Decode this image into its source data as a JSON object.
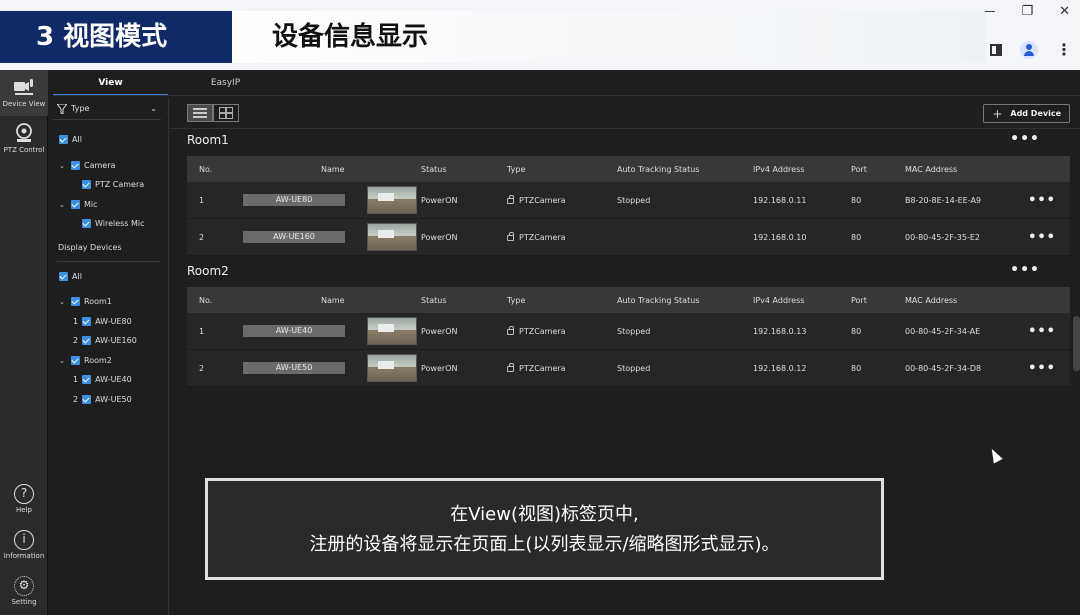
{
  "banner": {
    "number": "3 视图模式",
    "title": "设备信息显示"
  },
  "iconbar": {
    "device_view": "Device View",
    "ptz_control": "PTZ Control",
    "help": "Help",
    "information": "Information",
    "setting": "Setting"
  },
  "tabs": {
    "view": "View",
    "easyip": "EasyIP"
  },
  "sidebar": {
    "filter_label": "Type",
    "all": "All",
    "camera": "Camera",
    "ptz_camera": "PTZ Camera",
    "mic": "Mic",
    "wireless_mic": "Wireless Mic",
    "display_devices": "Display Devices",
    "all2": "All",
    "room1": "Room1",
    "room1_dev1_no": "1",
    "room1_dev1": "AW-UE80",
    "room1_dev2_no": "2",
    "room1_dev2": "AW-UE160",
    "room2": "Room2",
    "room2_dev1_no": "1",
    "room2_dev1": "AW-UE40",
    "room2_dev2_no": "2",
    "room2_dev2": "AW-UE50"
  },
  "toolbar": {
    "add_device": "Add Device"
  },
  "columns": {
    "no": "No.",
    "name": "Name",
    "status": "Status",
    "type": "Type",
    "tracking": "Auto Tracking Status",
    "ip": "IPv4 Address",
    "port": "Port",
    "mac": "MAC Address"
  },
  "rooms": [
    {
      "title": "Room1",
      "devices": [
        {
          "no": "1",
          "name": "AW-UE80",
          "status": "PowerON",
          "type": "PTZCamera",
          "tracking": "Stopped",
          "ip": "192.168.0.11",
          "port": "80",
          "mac": "B8-20-8E-14-EE-A9"
        },
        {
          "no": "2",
          "name": "AW-UE160",
          "status": "PowerON",
          "type": "PTZCamera",
          "tracking": "",
          "ip": "192.168.0.10",
          "port": "80",
          "mac": "00-80-45-2F-35-E2"
        }
      ]
    },
    {
      "title": "Room2",
      "devices": [
        {
          "no": "1",
          "name": "AW-UE40",
          "status": "PowerON",
          "type": "PTZCamera",
          "tracking": "Stopped",
          "ip": "192.168.0.13",
          "port": "80",
          "mac": "00-80-45-2F-34-AE"
        },
        {
          "no": "2",
          "name": "AW-UE50",
          "status": "PowerON",
          "type": "PTZCamera",
          "tracking": "Stopped",
          "ip": "192.168.0.12",
          "port": "80",
          "mac": "00-80-45-2F-34-D8"
        }
      ]
    }
  ],
  "callout": {
    "line1": "在View(视图)标签页中,",
    "line2": "注册的设备将显示在页面上(以列表显示/缩略图形式显示)。"
  }
}
